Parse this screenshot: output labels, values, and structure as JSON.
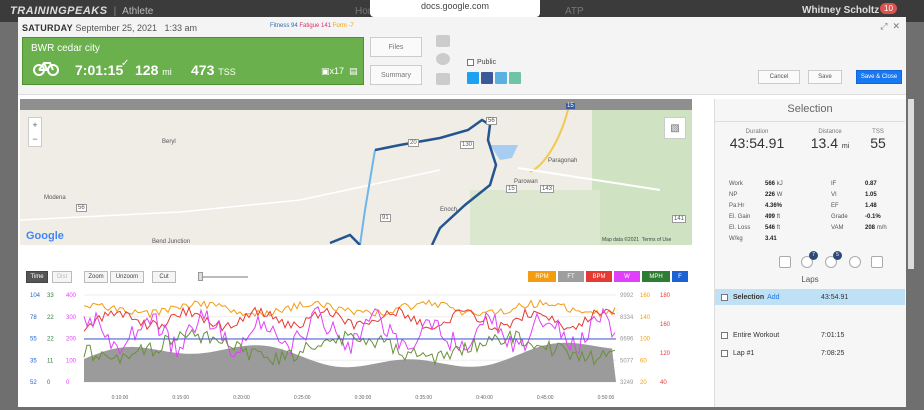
{
  "topbar": {
    "logo": "TRAININGPEAKS",
    "athlete": "Athlete",
    "home": "Home",
    "atp": "ATP",
    "user": "Whitney Scholtz",
    "badge": "10"
  },
  "url": "docs.google.com",
  "header": {
    "day": "SATURDAY",
    "date": "September 25, 2021",
    "time": "1:33 am",
    "fitness": "Fitness 94",
    "fatigue": "Fatigue 141",
    "form": "Form -7",
    "workout_title": "BWR cedar city",
    "duration": "7:01:15",
    "distance": "128",
    "distance_unit": "mi",
    "tss": "473",
    "tss_unit": "TSS",
    "kudos": "x17",
    "files_label": "Files",
    "summary_label": "Summary",
    "public_label": "Public",
    "cancel_label": "Cancel",
    "save_label": "Save",
    "save_close_label": "Save & Close"
  },
  "map": {
    "labels": [
      "Beryl",
      "Modena",
      "Paragonah",
      "Parowan",
      "Enoch",
      "Bend Junction"
    ],
    "roads": [
      "56",
      "130",
      "143",
      "20",
      "15",
      "91",
      "141",
      "56",
      "15"
    ],
    "attribution": "Map data ©2021",
    "terms": "Terms of Use",
    "google": "Google"
  },
  "chart": {
    "buttons": {
      "time": "Time",
      "dist": "Dist",
      "zoom": "Zoom",
      "unzoom": "Unzoom",
      "cut": "Cut"
    },
    "channels": [
      {
        "label": "RPM",
        "color": "#f39c12"
      },
      {
        "label": "FT",
        "color": "#9e9e9e"
      },
      {
        "label": "BPM",
        "color": "#e53935"
      },
      {
        "label": "W",
        "color": "#e040fb"
      },
      {
        "label": "MPH",
        "color": "#2e7d32"
      },
      {
        "label": "F",
        "color": "#1e63d6"
      }
    ],
    "left_axis_a": [
      "104",
      "78",
      "55",
      "35",
      "52"
    ],
    "left_axis_b": [
      "33",
      "22",
      "22",
      "11",
      "0"
    ],
    "left_axis_c": [
      "400",
      "300",
      "200",
      "100",
      "0"
    ],
    "right_axis_a": [
      "9992",
      "8334",
      "6696",
      "5077",
      "3249"
    ],
    "right_axis_b": [
      "160",
      "140",
      "100",
      "60",
      "20"
    ],
    "right_axis_c": [
      "180",
      "160",
      "120",
      "40"
    ],
    "time_ticks": [
      "0:10:00",
      "0:15:00",
      "0:20:00",
      "0:25:00",
      "0:30:00",
      "0:35:00",
      "0:40:00",
      "0:45:00",
      "0:50:00"
    ]
  },
  "selection": {
    "title": "Selection",
    "duration_label": "Duration",
    "duration": "43:54.91",
    "distance_label": "Distance",
    "distance": "13.4",
    "distance_unit": "mi",
    "tss_label": "TSS",
    "tss": "55",
    "stats_left": [
      {
        "label": "Work",
        "value": "566",
        "unit": "kJ"
      },
      {
        "label": "NP",
        "value": "226",
        "unit": "W"
      },
      {
        "label": "Pa:Hr",
        "value": "4.36%",
        "unit": ""
      },
      {
        "label": "El. Gain",
        "value": "499",
        "unit": "ft"
      },
      {
        "label": "El. Loss",
        "value": "546",
        "unit": "ft"
      },
      {
        "label": "W/kg",
        "value": "3.41",
        "unit": ""
      }
    ],
    "stats_right": [
      {
        "label": "IF",
        "value": "0.87",
        "unit": ""
      },
      {
        "label": "VI",
        "value": "1.05",
        "unit": ""
      },
      {
        "label": "EF",
        "value": "1.48",
        "unit": ""
      },
      {
        "label": "Grade",
        "value": "-0.1%",
        "unit": ""
      },
      {
        "label": "VAM",
        "value": "208",
        "unit": "m/h"
      }
    ],
    "tab_badges": [
      "7",
      "5"
    ],
    "laps_title": "Laps",
    "laps": [
      {
        "name": "Selection",
        "add": "Add",
        "time": "43:54.91"
      },
      {
        "name": "Entire Workout",
        "time": "7:01:15"
      },
      {
        "name": "Lap #1",
        "time": "7:08:25"
      }
    ]
  }
}
